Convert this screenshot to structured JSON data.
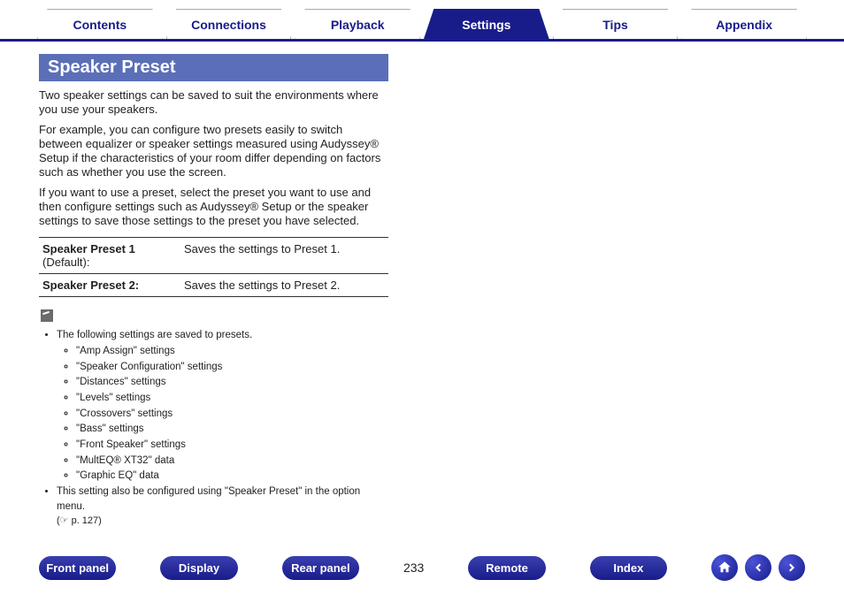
{
  "nav": {
    "tabs": [
      {
        "label": "Contents",
        "active": false
      },
      {
        "label": "Connections",
        "active": false
      },
      {
        "label": "Playback",
        "active": false
      },
      {
        "label": "Settings",
        "active": true
      },
      {
        "label": "Tips",
        "active": false
      },
      {
        "label": "Appendix",
        "active": false
      }
    ]
  },
  "section": {
    "title": "Speaker Preset",
    "paragraphs": [
      "Two speaker settings can be saved to suit the environments where you use your speakers.",
      "For example, you can configure two presets easily to switch between equalizer or speaker settings measured using Audyssey® Setup if the characteristics of your room differ depending on factors such as whether you use the screen.",
      "If you want to use a preset, select the preset you want to use and then configure settings such as Audyssey® Setup or the speaker settings to save those settings to the preset you have selected."
    ],
    "table": [
      {
        "name": "Speaker Preset 1",
        "suffix": "(Default):",
        "desc": "Saves the settings to Preset 1."
      },
      {
        "name": "Speaker Preset 2:",
        "suffix": "",
        "desc": "Saves the settings to Preset 2."
      }
    ],
    "notes_intro": "The following settings are saved to presets.",
    "saved_items": [
      "\"Amp Assign\" settings",
      "\"Speaker Configuration\" settings",
      "\"Distances\" settings",
      "\"Levels\" settings",
      "\"Crossovers\" settings",
      "\"Bass\" settings",
      "\"Front Speaker\" settings",
      "\"MultEQ® XT32\" data",
      "\"Graphic EQ\" data"
    ],
    "note_also": "This setting also be configured using \"Speaker Preset\" in the option menu.",
    "note_ref": "(☞ p. 127)"
  },
  "footer": {
    "buttons": [
      "Front panel",
      "Display",
      "Rear panel",
      "Remote",
      "Index"
    ],
    "page_number": "233"
  }
}
